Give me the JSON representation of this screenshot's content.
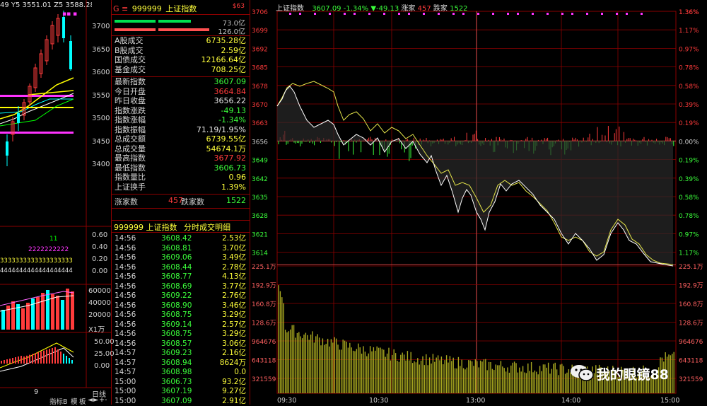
{
  "left_chart": {
    "header": "49 Y5 3551.01 Z5 3588.28",
    "price_ticks": [
      "3700",
      "3650",
      "3600",
      "3550",
      "3500",
      "3450",
      "3400"
    ],
    "ind_ticks": [
      "0.60",
      "0.40",
      "0.20",
      "0.00"
    ],
    "ind_text1": "11",
    "ind_text2": "2222222222",
    "ind_text3": "3333333333333333333",
    "ind_text4": "4444444444444444444",
    "vol_ticks": [
      "60000",
      "40000",
      "20000",
      "X1万"
    ],
    "macd_ticks": [
      "50.00",
      "25.00",
      "0.00"
    ],
    "bottom_label": "9",
    "bottom_buttons": [
      "指标B",
      "模",
      "板"
    ],
    "nav_arrows": [
      "◄",
      "►",
      "+",
      "-"
    ],
    "right_bottom_label": "日线"
  },
  "quote_panel": {
    "code_prefix": "G ≡",
    "code": "999999",
    "name": "上证指数",
    "badge": "$63",
    "bar_label1": "73.0亿",
    "bar_label2": "126.0亿",
    "stats1": [
      {
        "k": "A股成交",
        "v": "6735.28亿",
        "c": "yellow"
      },
      {
        "k": "B股成交",
        "v": "2.59亿",
        "c": "yellow"
      },
      {
        "k": "国债成交",
        "v": "12166.64亿",
        "c": "yellow"
      },
      {
        "k": "基金成交",
        "v": "708.25亿",
        "c": "yellow"
      }
    ],
    "stats2": [
      {
        "k": "最新指数",
        "v": "3607.09",
        "c": "green"
      },
      {
        "k": "今日开盘",
        "v": "3664.84",
        "c": "red"
      },
      {
        "k": "昨日收盘",
        "v": "3656.22",
        "c": "white"
      },
      {
        "k": "指数涨跌",
        "v": "-49.13",
        "c": "green"
      },
      {
        "k": "指数涨幅",
        "v": "-1.34%",
        "c": "green"
      },
      {
        "k": "指数振幅",
        "v": "71.19/1.95%",
        "c": "white"
      },
      {
        "k": "总成交额",
        "v": "6739.55亿",
        "c": "yellow"
      },
      {
        "k": "总成交量",
        "v": "54674.1万",
        "c": "yellow"
      },
      {
        "k": "最高指数",
        "v": "3677.92",
        "c": "red"
      },
      {
        "k": "最低指数",
        "v": "3606.73",
        "c": "green"
      },
      {
        "k": "指数量比",
        "v": "0.96",
        "c": "yellow"
      },
      {
        "k": "上证换手",
        "v": "1.39%",
        "c": "yellow"
      }
    ],
    "up_label": "涨家数",
    "up_count": "457",
    "down_label": "跌家数",
    "down_count": "1522",
    "detail_title_code": "999999",
    "detail_title_name": "上证指数",
    "detail_title_suffix": "分时成交明细",
    "ticks": [
      {
        "t": "14:56",
        "p": "3608.42",
        "q": "2.53亿",
        "c": "green"
      },
      {
        "t": "14:56",
        "p": "3608.81",
        "q": "3.70亿",
        "c": "green"
      },
      {
        "t": "14:56",
        "p": "3609.06",
        "q": "3.49亿",
        "c": "green"
      },
      {
        "t": "14:56",
        "p": "3608.44",
        "q": "2.78亿",
        "c": "green"
      },
      {
        "t": "14:56",
        "p": "3608.77",
        "q": "4.13亿",
        "c": "green"
      },
      {
        "t": "14:56",
        "p": "3608.69",
        "q": "3.77亿",
        "c": "green"
      },
      {
        "t": "14:56",
        "p": "3609.22",
        "q": "2.76亿",
        "c": "green"
      },
      {
        "t": "14:56",
        "p": "3608.90",
        "q": "3.46亿",
        "c": "green"
      },
      {
        "t": "14:56",
        "p": "3608.75",
        "q": "3.29亿",
        "c": "green"
      },
      {
        "t": "14:56",
        "p": "3609.14",
        "q": "2.57亿",
        "c": "green"
      },
      {
        "t": "14:56",
        "p": "3608.75",
        "q": "3.29亿",
        "c": "green"
      },
      {
        "t": "14:56",
        "p": "3608.57",
        "q": "3.06亿",
        "c": "green"
      },
      {
        "t": "14:57",
        "p": "3609.23",
        "q": "2.16亿",
        "c": "green"
      },
      {
        "t": "14:57",
        "p": "3608.94",
        "q": "8624万",
        "c": "green"
      },
      {
        "t": "14:57",
        "p": "3608.98",
        "q": "0.0",
        "c": "green"
      },
      {
        "t": "15:00",
        "p": "3606.73",
        "q": "93.2亿",
        "c": "green"
      },
      {
        "t": "15:00",
        "p": "3607.19",
        "q": "9.27亿",
        "c": "green"
      },
      {
        "t": "15:00",
        "p": "3607.09",
        "q": "2.91亿",
        "c": "green"
      }
    ]
  },
  "main_chart": {
    "header_name": "上证指数",
    "header_price": "3607.09",
    "header_pct": "-1.34%",
    "header_chg": "▼-49.13",
    "header_up_label": "涨家",
    "header_up": "457",
    "header_down_label": "跌家",
    "header_down": "1522",
    "top_right_pct": "1.36%",
    "left_ticks": [
      "3706",
      "3699",
      "3692",
      "3685",
      "3678",
      "3670",
      "3663",
      "3656",
      "3649",
      "3642",
      "3635",
      "3628",
      "3621",
      "3614"
    ],
    "right_ticks": [
      "1.36%",
      "1.17%",
      "0.97%",
      "0.78%",
      "0.58%",
      "0.39%",
      "0.19%",
      "0.00%",
      "0.19%",
      "0.39%",
      "0.58%",
      "0.78%",
      "0.97%",
      "1.17%"
    ],
    "vol_left_ticks": [
      "225.1万",
      "192.9万",
      "160.8万",
      "128.6万",
      "964676",
      "643118",
      "321559"
    ],
    "vol_right_ticks": [
      "225.1万",
      "192.9万",
      "160.8万",
      "128.6万",
      "964676",
      "643118",
      "321559"
    ],
    "time_labels": [
      "09:30",
      "10:30",
      "13:00",
      "14:00",
      "15:00"
    ],
    "watermark": "我的眼镜88",
    "colors": {
      "up": "#ff3b3b",
      "down": "#3bff3b",
      "price": "#ffffff",
      "avg": "#e6e64a",
      "grid": "#8b0000"
    }
  }
}
